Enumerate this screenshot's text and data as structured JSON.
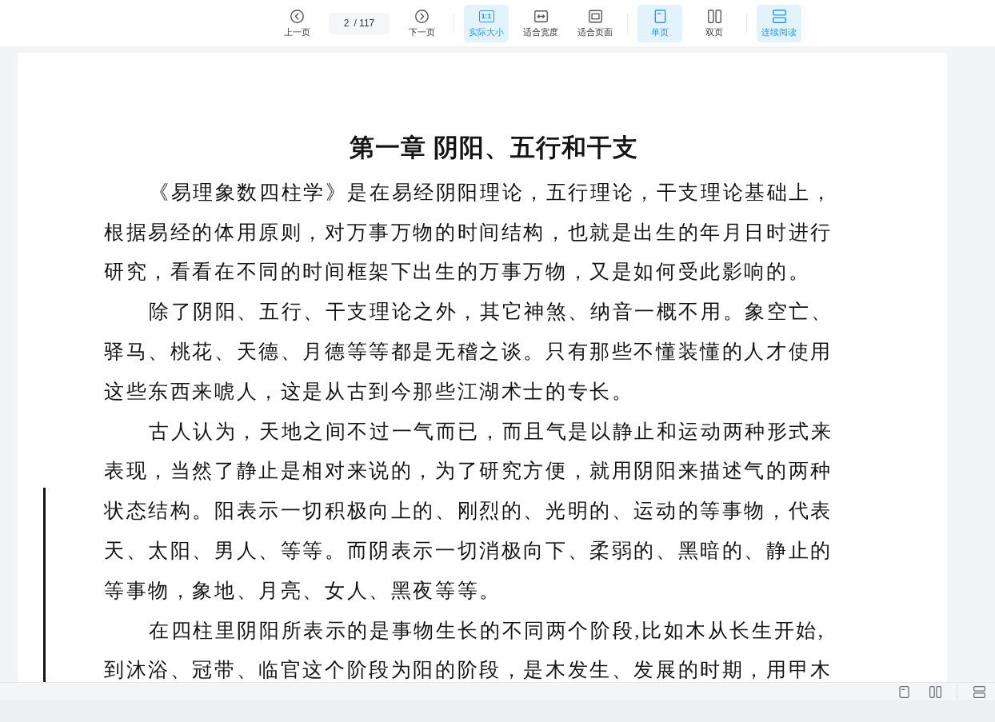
{
  "toolbar": {
    "prev": {
      "label": "上一页"
    },
    "page_field": {
      "value": "2",
      "total": "/ 117"
    },
    "next": {
      "label": "下一页"
    },
    "groups": [
      {
        "buttons": [
          {
            "kind": "actual-size",
            "label": "实际大小",
            "icon_text": "1:1",
            "selected": true
          },
          {
            "kind": "fit-width",
            "label": "适合宽度",
            "selected": false
          },
          {
            "kind": "fit-page",
            "label": "适合页面",
            "selected": false
          }
        ]
      },
      {
        "buttons": [
          {
            "kind": "single",
            "label": "单页",
            "selected": true
          },
          {
            "kind": "double",
            "label": "双页",
            "selected": false
          }
        ]
      },
      {
        "buttons": [
          {
            "kind": "continuous",
            "label": "连续阅读",
            "selected": true
          }
        ]
      }
    ]
  },
  "document": {
    "title": "第一章 阴阳、五行和干支",
    "paragraphs": [
      {
        "lines": [
          "《易理象数四柱学》是在易经阴阳理论，五行理论，干支理论基础上，",
          "根据易经的体用原则，对万事万物的时间结构，也就是出生的年月日时进行",
          "研究，看看在不同的时间框架下出生的万事万物，又是如何受此影响的。"
        ]
      },
      {
        "lines": [
          "除了阴阳、五行、干支理论之外，其它神煞、纳音一概不用。象空亡、",
          "驿马、桃花、天德、月德等等都是无稽之谈。只有那些不懂装懂的人才使用",
          "这些东西来唬人，这是从古到今那些江湖术士的专长。"
        ]
      },
      {
        "lines": [
          "古人认为，天地之间不过一气而已，而且气是以静止和运动两种形式来",
          "表现，当然了静止是相对来说的，为了研究方便，就用阴阳来描述气的两种",
          "状态结构。阳表示一切积极向上的、刚烈的、光明的、运动的等事物，代表",
          "天、太阳、男人、等等。而阴表示一切消极向下、柔弱的、黑暗的、静止的",
          "等事物，象地、月亮、女人、黑夜等等。"
        ]
      },
      {
        "lines": [
          "在四柱里阴阳所表示的是事物生长的不同两个阶段,比如木从长生开始,",
          "到沐浴、冠带、临官这个阶段为阳的阶段，是木发生、发展的时期，用甲木"
        ]
      }
    ]
  },
  "status_bar": {
    "groups": [
      {
        "buttons": [
          {
            "kind": "single"
          },
          {
            "kind": "double"
          }
        ]
      },
      {
        "buttons": [
          {
            "kind": "continuous"
          }
        ]
      }
    ]
  }
}
